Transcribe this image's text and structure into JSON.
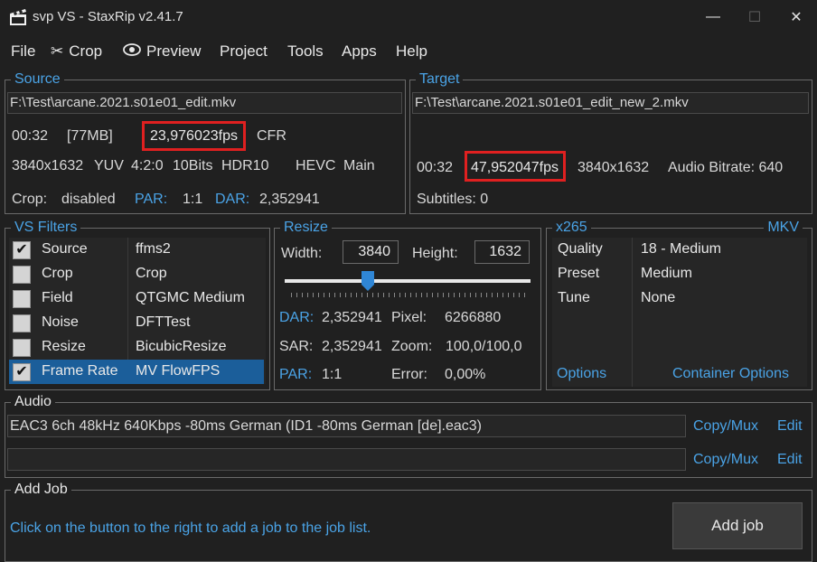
{
  "window": {
    "title": "svp VS - StaxRip v2.41.7",
    "controls": {
      "minimize": "—",
      "maximize": "☐",
      "close": "✕"
    }
  },
  "menu": {
    "file": "File",
    "crop": "Crop",
    "preview": "Preview",
    "project": "Project",
    "tools": "Tools",
    "apps": "Apps",
    "help": "Help"
  },
  "source": {
    "legend": "Source",
    "path": "F:\\Test\\arcane.2021.s01e01_edit.mkv",
    "duration": "00:32",
    "size": "[77MB]",
    "fps": "23,976023fps",
    "rate_mode": "CFR",
    "resolution": "3840x1632",
    "colorspace": "YUV",
    "subsampling": "4:2:0",
    "bitdepth": "10Bits",
    "hdr": "HDR10",
    "codec": "HEVC",
    "profile": "Main",
    "crop_label": "Crop:",
    "crop_value": "disabled",
    "par_label": "PAR:",
    "par_value": "1:1",
    "dar_label": "DAR:",
    "dar_value": "2,352941"
  },
  "target": {
    "legend": "Target",
    "path": "F:\\Test\\arcane.2021.s01e01_edit_new_2.mkv",
    "duration": "00:32",
    "fps": "47,952047fps",
    "resolution": "3840x1632",
    "audio_bitrate": "Audio Bitrate: 640",
    "subtitles": "Subtitles: 0"
  },
  "filters": {
    "legend": "VS Filters",
    "rows": [
      {
        "name": "Source",
        "value": "ffms2",
        "checked": true,
        "selected": false
      },
      {
        "name": "Crop",
        "value": "Crop",
        "checked": false,
        "selected": false
      },
      {
        "name": "Field",
        "value": "QTGMC Medium",
        "checked": false,
        "selected": false
      },
      {
        "name": "Noise",
        "value": "DFTTest",
        "checked": false,
        "selected": false
      },
      {
        "name": "Resize",
        "value": "BicubicResize",
        "checked": false,
        "selected": false
      },
      {
        "name": "Frame Rate",
        "value": "MV FlowFPS",
        "checked": true,
        "selected": true
      }
    ]
  },
  "resize": {
    "legend": "Resize",
    "width_label": "Width:",
    "width_value": "3840",
    "height_label": "Height:",
    "height_value": "1632",
    "slider_position": 0.34,
    "dar_label": "DAR:",
    "dar_value": "2,352941",
    "pixel_label": "Pixel:",
    "pixel_value": "6266880",
    "sar_label": "SAR:",
    "sar_value": "2,352941",
    "zoom_label": "Zoom:",
    "zoom_value": "100,0/100,0",
    "par_label": "PAR:",
    "par_value": "1:1",
    "error_label": "Error:",
    "error_value": "0,00%"
  },
  "encoder": {
    "legend": "x265",
    "container_legend": "MKV",
    "rows": [
      {
        "name": "Quality",
        "value": "18 - Medium"
      },
      {
        "name": "Preset",
        "value": "Medium"
      },
      {
        "name": "Tune",
        "value": "None"
      }
    ],
    "options_link": "Options",
    "container_options_link": "Container Options"
  },
  "audio": {
    "legend": "Audio",
    "track1": "EAC3 6ch 48kHz 640Kbps -80ms German (ID1 -80ms German [de].eac3)",
    "track2": "",
    "copy_mux_1": "Copy/Mux",
    "edit_1": "Edit",
    "copy_mux_2": "Copy/Mux",
    "edit_2": "Edit"
  },
  "add_job": {
    "legend": "Add Job",
    "hint": "Click on the button to the right to add a job to the job list.",
    "button": "Add job"
  },
  "colors": {
    "background": "#202020",
    "accent_blue": "#4aa3e6",
    "selection": "#1b5e9a",
    "highlight_red": "#e02020"
  }
}
